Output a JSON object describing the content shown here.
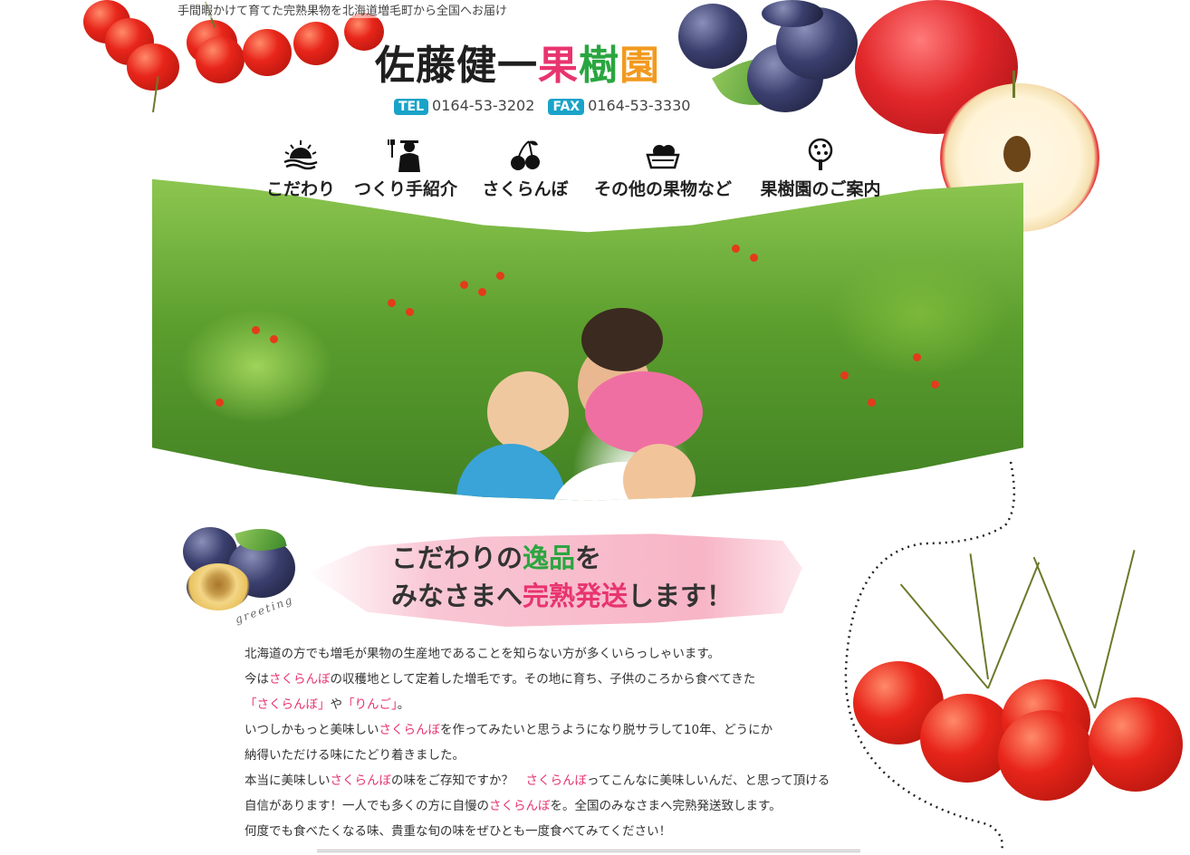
{
  "header": {
    "tagline": "手間暇かけて育てた完熟果物を北海道増毛町から全国へお届け",
    "logo": {
      "part1": "佐藤健一",
      "c1": "果",
      "c2": "樹",
      "c3": "園"
    },
    "tel_label": "TEL",
    "tel_number": "0164-53-3202",
    "fax_label": "FAX",
    "fax_number": "0164-53-3330"
  },
  "nav": {
    "items": [
      {
        "label": "こだわり",
        "icon": "sunrise-icon"
      },
      {
        "label": "つくり手紹介",
        "icon": "farmer-icon"
      },
      {
        "label": "さくらんぼ",
        "icon": "cherry-icon"
      },
      {
        "label": "その他の果物など",
        "icon": "fruit-basket-icon"
      },
      {
        "label": "果樹園のご案内",
        "icon": "tree-icon"
      }
    ]
  },
  "greeting": {
    "line1_a": "こだわりの",
    "line1_b": "逸品",
    "line1_c": "を",
    "line2_a": "みなさまへ",
    "line2_b": "完熟発送",
    "line2_c": "します！",
    "label": "greeting"
  },
  "body": {
    "p1": "北海道の方でも増毛が果物の生産地であることを知らない方が多くいらっしゃいます。",
    "p2_a": "今は",
    "p2_b": "さくらんぼ",
    "p2_c": "の収穫地として定着した増毛です。その地に育ち、子供のころから食べてきた",
    "p3_a": "「さくらんぼ」",
    "p3_b": "や",
    "p3_c": "「りんご」",
    "p3_d": "。",
    "p4_a": "いつしかもっと美味しい",
    "p4_b": "さくらんぼ",
    "p4_c": "を作ってみたいと思うようになり脱サラして10年、どうにか",
    "p5": "納得いただける味にたどり着きました。",
    "p6_a": "本当に美味しい",
    "p6_b": "さくらんぼ",
    "p6_c": "の味をご存知ですか？　",
    "p6_d": "さくらんぼ",
    "p6_e": "ってこんなに美味しいんだ、と思って頂ける",
    "p7_a": "自信があります！一人でも多くの方に自慢の",
    "p7_b": "さくらんぼ",
    "p7_c": "を。全国のみなさまへ完熟発送致します。",
    "p8": "何度でも食べたくなる味、貴重な旬の味をぜひとも一度食べてみてください！"
  },
  "colors": {
    "accent_pink": "#e8346f",
    "accent_green": "#2aa63f",
    "accent_orange": "#f29a1f",
    "contact_blue": "#1aa3c9"
  }
}
